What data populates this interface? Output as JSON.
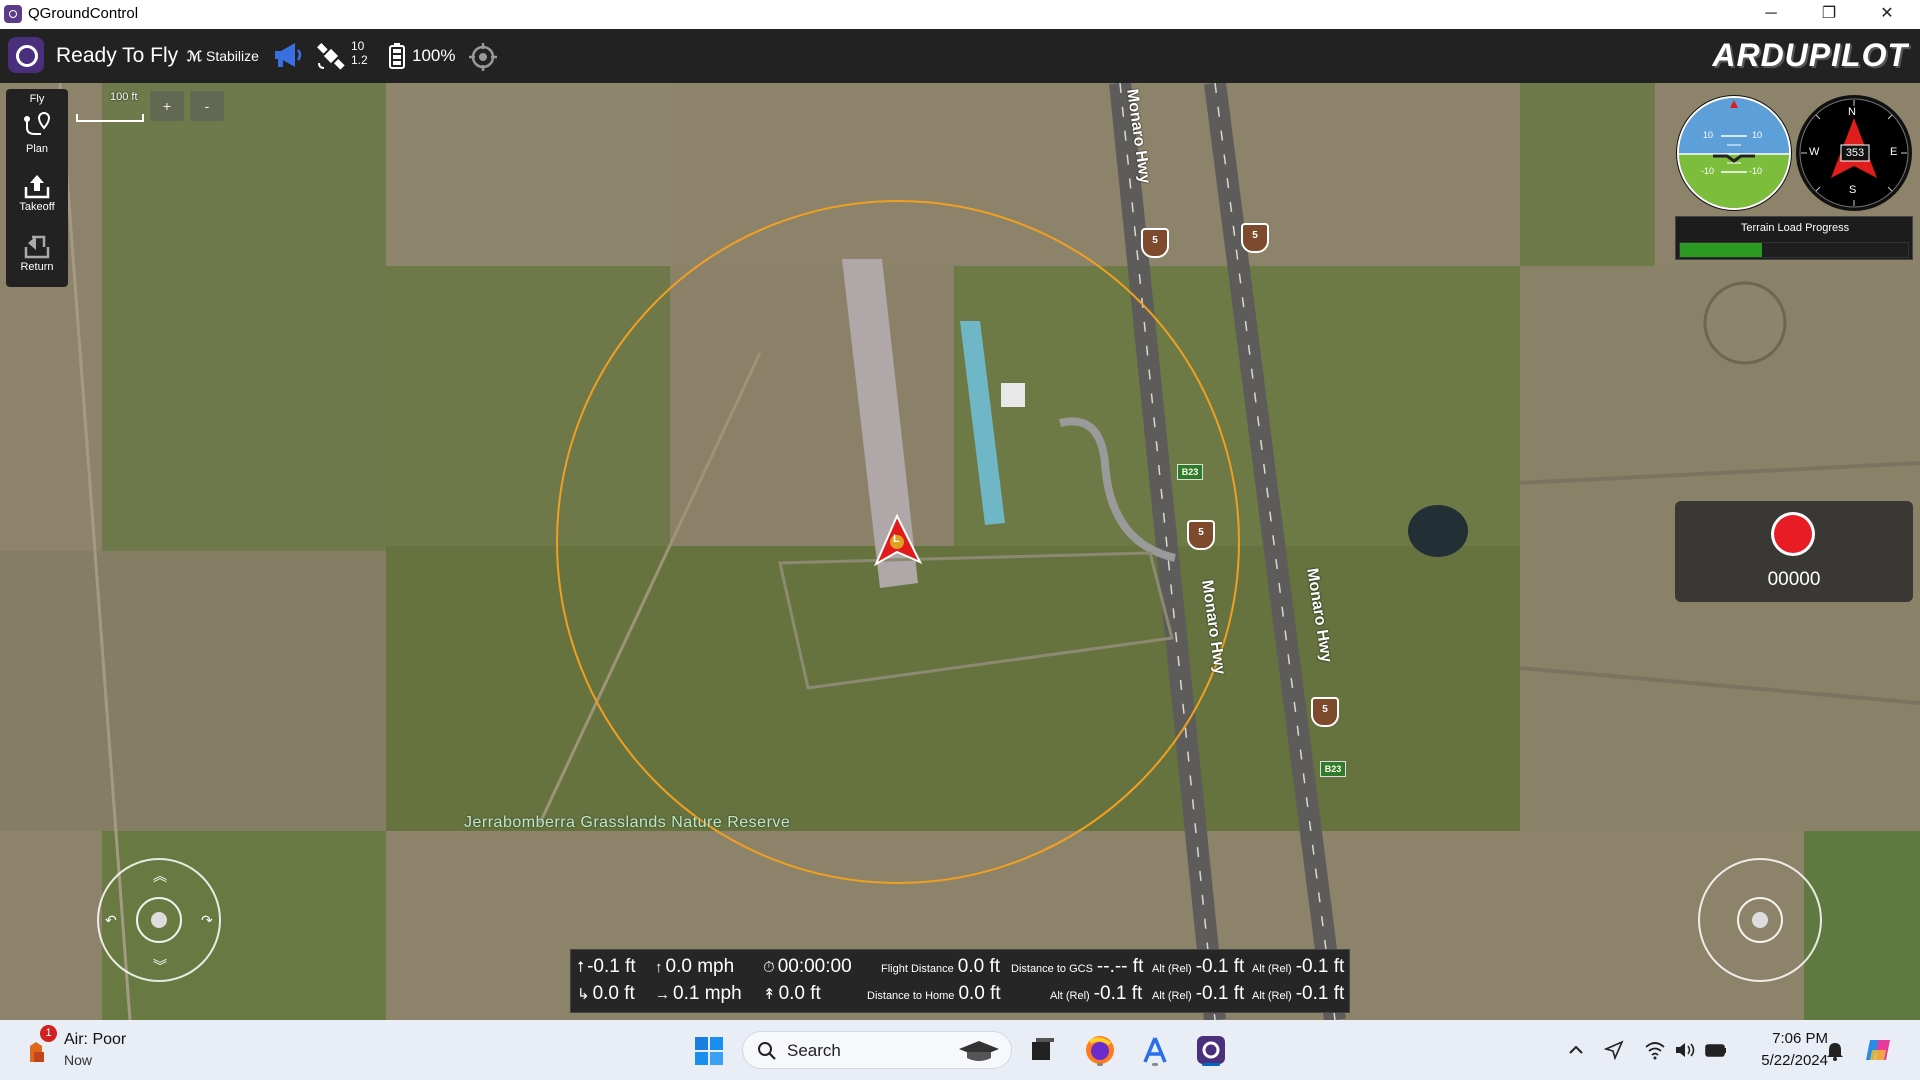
{
  "window": {
    "title": "QGroundControl",
    "controls": {
      "minimize": "─",
      "maximize": "❐",
      "close": "✕"
    }
  },
  "toolbar": {
    "status": "Ready To Fly",
    "flight_mode": "Stabilize",
    "gps": {
      "satellites": "10",
      "hdop": "1.2"
    },
    "battery": "100%",
    "brand": "ARDUPILOT",
    "icons": [
      "qgc-logo-icon",
      "messages-megaphone-icon",
      "gps-satellite-icon",
      "battery-icon",
      "rc-rssi-icon"
    ]
  },
  "toolstrip": {
    "header": "Fly",
    "items": [
      {
        "label": "Plan",
        "icon": "plan-route-icon"
      },
      {
        "label": "Takeoff",
        "icon": "takeoff-arrow-icon"
      },
      {
        "label": "Return",
        "icon": "return-arrow-icon"
      }
    ]
  },
  "map": {
    "scale_label": "100 ft",
    "zoom_in": "+",
    "zoom_out": "-",
    "area_label": "Jerrabomberra Grasslands Nature Reserve",
    "road_labels": [
      "Monaro Hwy",
      "Monaro Hwy",
      "Monaro Hwy"
    ],
    "road_shields": [
      "5",
      "5",
      "5",
      "5"
    ],
    "route_markers": [
      "B23",
      "B23"
    ],
    "vehicle_marker": "L",
    "geofence_color": "#f0a020"
  },
  "instruments": {
    "attitude_ticks": {
      "upper_left": "10",
      "upper_right": "10",
      "lower_left": "-10",
      "lower_right": "-10"
    },
    "compass": {
      "heading": "353",
      "n": "N",
      "s": "S",
      "e": "E",
      "w": "W"
    },
    "terrain": {
      "label": "Terrain Load Progress",
      "progress": 0.36
    }
  },
  "recorder": {
    "time": "00000",
    "button_color": "#e81c24"
  },
  "telemetry": {
    "altitude": "-0.1 ft",
    "vertical_speed": "0.0 mph",
    "flight_time": "00:00:00",
    "flight_distance_label": "Flight Distance",
    "flight_distance": "0.0 ft",
    "distance_gcs_label": "Distance to GCS",
    "distance_gcs": "--.-- ft",
    "horizontal_distance": "0.0 ft",
    "ground_speed": "0.1 mph",
    "distance_to_wp": "0.0 ft",
    "distance_home_label": "Distance to Home",
    "distance_home": "0.0 ft",
    "alt_rel_label": "Alt (Rel)",
    "alt_rel_values": [
      "-0.1 ft",
      "-0.1 ft",
      "-0.1 ft",
      "-0.1 ft",
      "-0.1 ft"
    ]
  },
  "taskbar": {
    "weather_title": "Air: Poor",
    "weather_sub": "Now",
    "weather_badge": "1",
    "search_placeholder": "Search",
    "time": "7:06 PM",
    "date": "5/22/2024",
    "apps": [
      "windows-start-icon",
      "search-icon",
      "task-view-icon",
      "firefox-icon",
      "app-store-icon",
      "qgroundcontrol-icon"
    ],
    "tray": [
      "chevron-up-icon",
      "location-icon",
      "wifi-icon",
      "volume-icon",
      "battery-icon",
      "notification-bell-icon",
      "copilot-icon"
    ]
  }
}
